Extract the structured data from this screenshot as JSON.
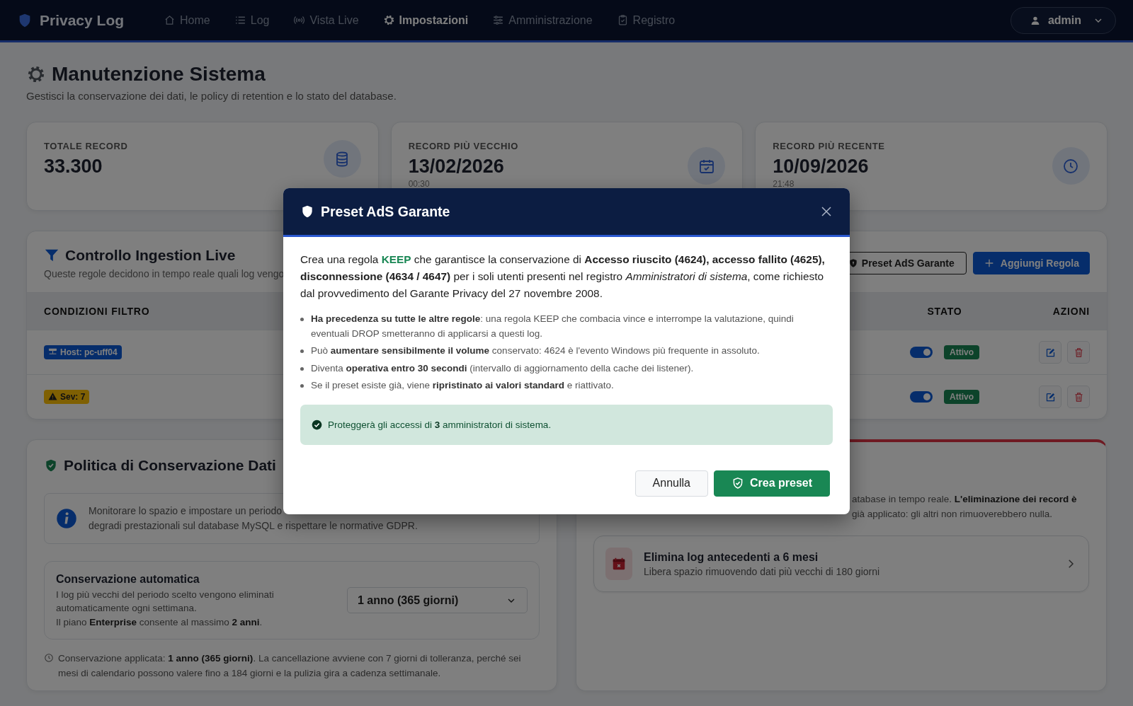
{
  "nav": {
    "brand": "Privacy Log",
    "items": [
      {
        "label": "Home",
        "selected": false
      },
      {
        "label": "Log",
        "selected": false
      },
      {
        "label": "Vista Live",
        "selected": false
      },
      {
        "label": "Impostazioni",
        "selected": true
      },
      {
        "label": "Amministrazione",
        "selected": false
      },
      {
        "label": "Registro",
        "selected": false
      }
    ],
    "user": "admin"
  },
  "page": {
    "title": "Manutenzione Sistema",
    "subtitle": "Gestisci la conservazione dei dati, le policy di retention e lo stato del database."
  },
  "stats": [
    {
      "label": "TOTALE RECORD",
      "value": "33.300"
    },
    {
      "label": "RECORD PIÙ VECCHIO",
      "value": "13/02/2026",
      "sub": "00:30"
    },
    {
      "label": "RECORD PIÙ RECENTE",
      "value": "10/09/2026",
      "sub": "21:48"
    }
  ],
  "ingestion": {
    "title": "Controllo Ingestion Live",
    "subtitle": "Queste regole decidono in tempo reale quali log vengo",
    "buttons": [
      {
        "label": "Preset AdS Garante",
        "kind": "outline"
      },
      {
        "label": "Aggiungi Regola",
        "kind": "primary"
      }
    ],
    "columns": [
      "CONDIZIONI FILTRO",
      "STATO",
      "AZIONI"
    ],
    "rows": [
      {
        "condition": {
          "label": "Host: pc-uff04",
          "kind": "host"
        },
        "on": true,
        "status": "Attivo"
      },
      {
        "condition": {
          "label": "Sev: 7",
          "kind": "severity"
        },
        "on": true,
        "status": "Attivo"
      }
    ]
  },
  "retention": {
    "title": "Politica di Conservazione Dati",
    "info_lines": [
      "Monitorare lo spazio e impostare un periodo",
      "degradi prestazionali sul database MySQL e rispettare le normative GDPR."
    ],
    "auto": {
      "title": "Conservazione automatica",
      "description": "I log più vecchi del periodo scelto vengono eliminati automaticamente ogni settimana.",
      "limit": "Il piano **Enterprise** consente al massimo **2 anni**.",
      "select": "1 anno (365 giorni)"
    },
    "applied": "Conservazione applicata: **1 anno (365 giorni)**. La cancellazione avviene con 7 giorni di tolleranza, perché sei mesi di calendario possono valere fino a 184 giorni e la pulizia gira a cadenza settimanale."
  },
  "maintenance": {
    "lines": [
      "atabase in tempo reale. **L'eliminazione dei record è**",
      "già applicato: gli altri non rimuoverebbero nulla."
    ],
    "actions": [
      {
        "title": "Elimina log antecedenti a 6 mesi",
        "description": "Libera spazio rimuovendo dati più vecchi di 180 giorni"
      }
    ]
  },
  "modal": {
    "title": "Preset AdS Garante",
    "intro": "Crea una regola **KEEP** che garantisce la conservazione di **Accesso riuscito (4624), accesso fallito (4625), disconnessione (4634 / 4647)** per i soli utenti presenti nel registro *Amministratori di sistema*, come richiesto dal provvedimento del Garante Privacy del 27 novembre 2008.",
    "bullets": [
      "**Ha precedenza su tutte le altre regole**: una regola KEEP che combacia vince e interrompe la valutazione, quindi eventuali DROP smetteranno di applicarsi a questi log.",
      "Può **aumentare sensibilmente il volume** conservato: 4624 è l'evento Windows più frequente in assoluto.",
      "Diventa **operativa entro 30 secondi** (intervallo di aggiornamento della cache dei listener).",
      "Se il preset esiste già, viene **ripristinato ai valori standard** e riattivato."
    ],
    "notice": "Proteggerà gli accessi di **3** amministratori di sistema.",
    "buttons": [
      {
        "label": "Annulla",
        "kind": "secondary"
      },
      {
        "label": "Crea preset",
        "kind": "success"
      }
    ]
  }
}
